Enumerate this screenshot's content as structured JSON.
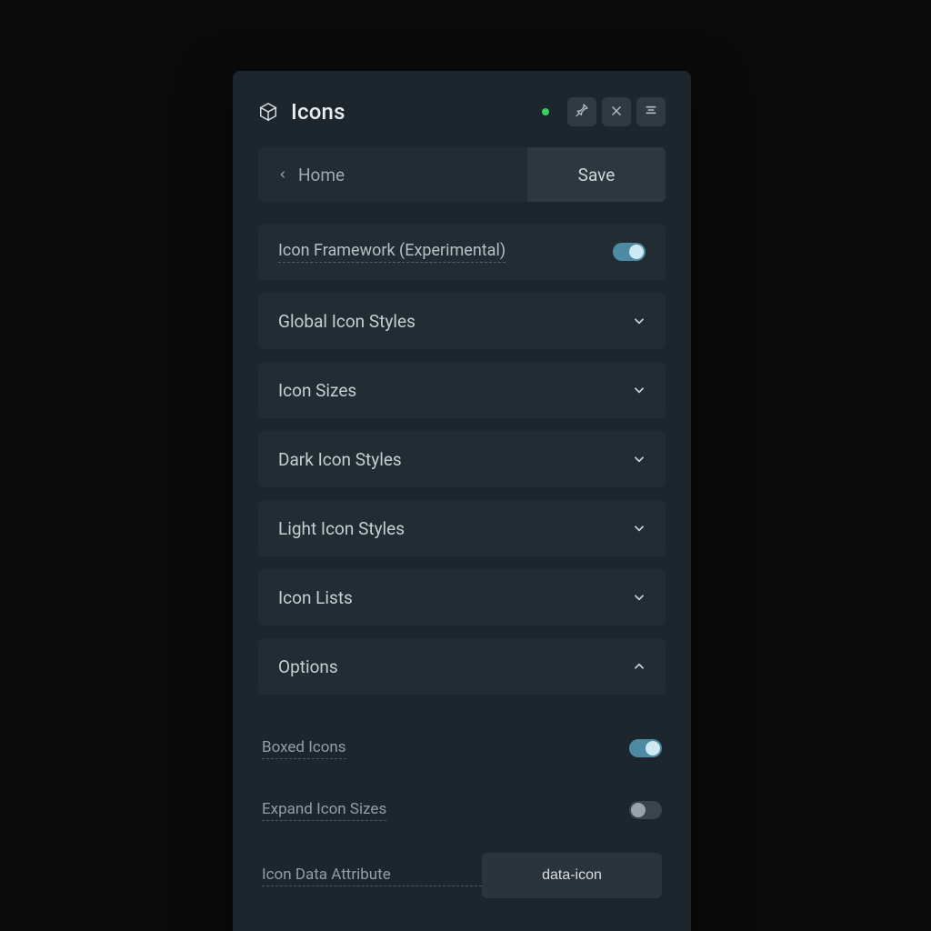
{
  "header": {
    "title": "Icons"
  },
  "nav": {
    "back_label": "Home",
    "save_label": "Save"
  },
  "framework": {
    "label": "Icon Framework (Experimental)",
    "enabled": true
  },
  "accordions": {
    "global_icon_styles": {
      "label": "Global Icon Styles",
      "expanded": false
    },
    "icon_sizes": {
      "label": "Icon Sizes",
      "expanded": false
    },
    "dark_icon_styles": {
      "label": "Dark Icon Styles",
      "expanded": false
    },
    "light_icon_styles": {
      "label": "Light Icon Styles",
      "expanded": false
    },
    "icon_lists": {
      "label": "Icon Lists",
      "expanded": false
    },
    "options": {
      "label": "Options",
      "expanded": true
    }
  },
  "options": {
    "boxed_icons": {
      "label": "Boxed Icons",
      "enabled": true
    },
    "expand_icon_sizes": {
      "label": "Expand Icon Sizes",
      "enabled": false
    },
    "icon_data_attribute": {
      "label": "Icon Data Attribute",
      "value": "data-icon"
    }
  }
}
